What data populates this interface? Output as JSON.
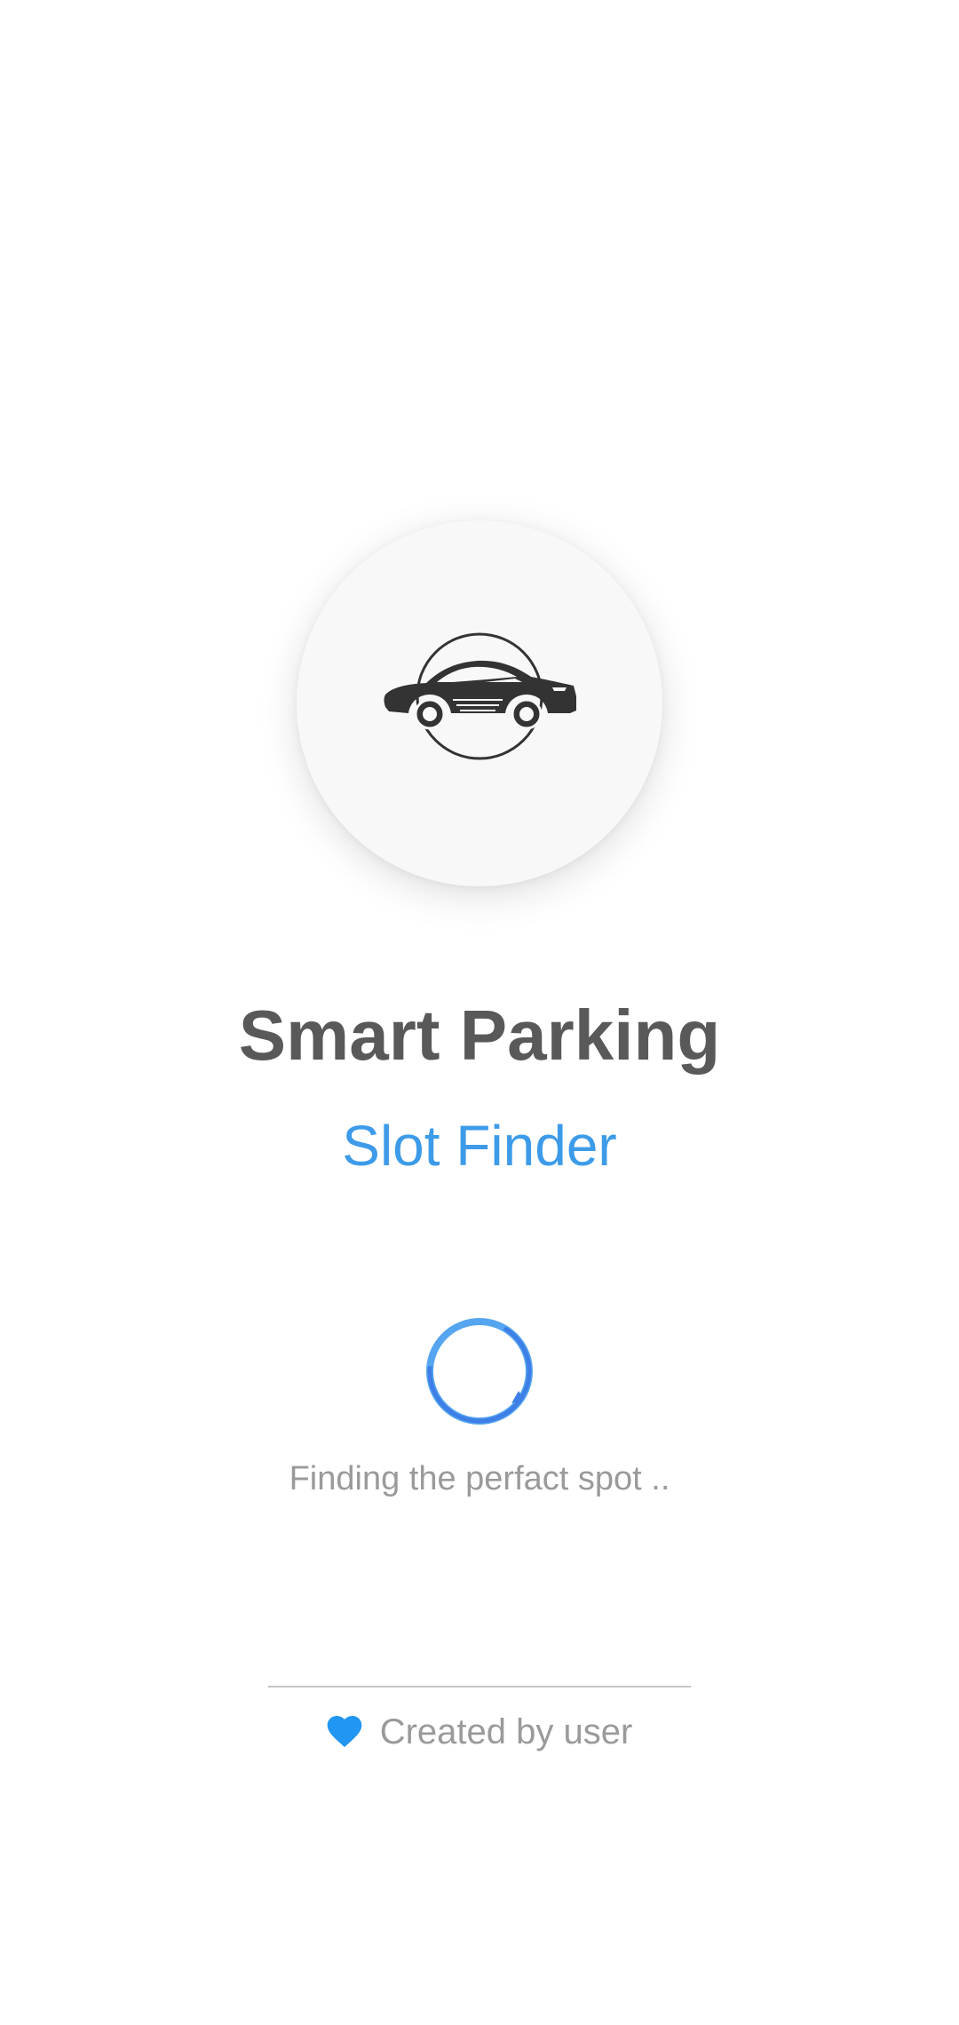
{
  "app": {
    "title": "Smart Parking",
    "subtitle": "Slot Finder",
    "logo_icon": "car-logo-icon"
  },
  "loading": {
    "text": "Finding the perfact spot ..",
    "spinner_icon": "loading-spinner-icon"
  },
  "footer": {
    "credit_text": "Created by user",
    "heart_icon": "heart-icon"
  },
  "colors": {
    "title": "#595959",
    "accent": "#3d9be9",
    "muted_text": "#9a9a9a",
    "heart": "#2196f3",
    "background": "#ffffff"
  }
}
